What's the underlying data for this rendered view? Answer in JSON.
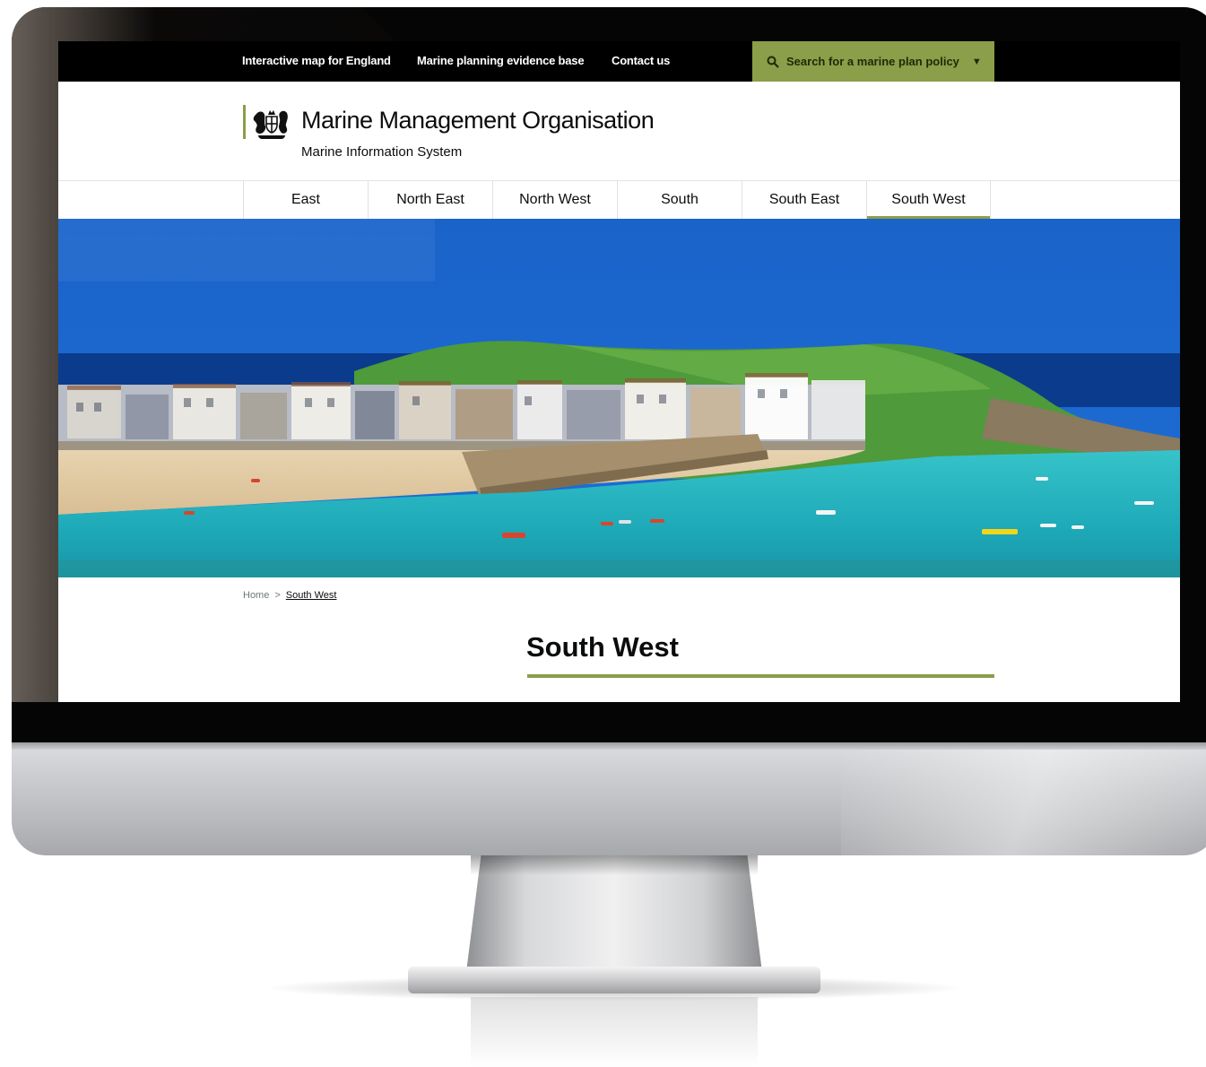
{
  "topbar": {
    "links": [
      "Interactive map for England",
      "Marine planning evidence base",
      "Contact us"
    ],
    "search_label": "Search for a marine plan policy",
    "search_color": "#8b9e49"
  },
  "header": {
    "crest_icon": "royal-crest-icon",
    "title": "Marine Management Organisation",
    "subtitle": "Marine Information System"
  },
  "region_nav": {
    "items": [
      "East",
      "North East",
      "North West",
      "South",
      "South East",
      "South West"
    ],
    "active": "South West"
  },
  "breadcrumb": {
    "home": "Home",
    "separator": ">",
    "current": "South West"
  },
  "page": {
    "title": "South West",
    "accent": "#8b9e49"
  }
}
